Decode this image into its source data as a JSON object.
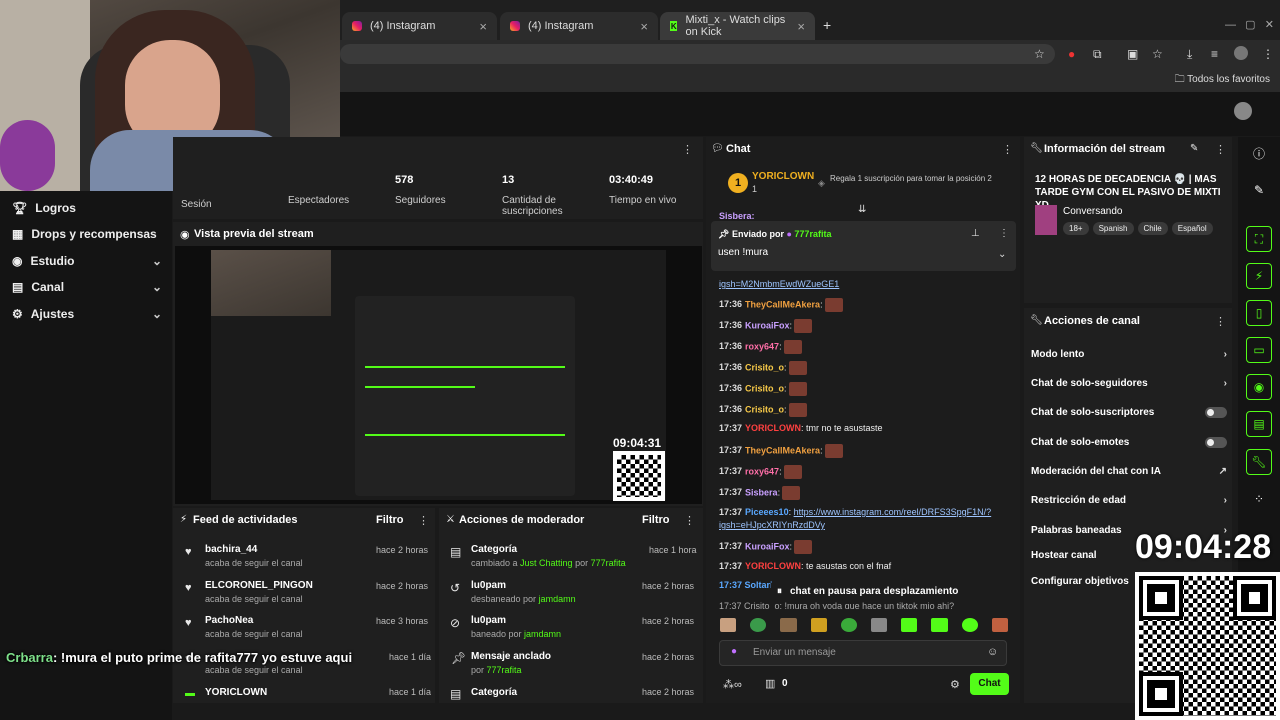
{
  "browser": {
    "tabs": [
      {
        "label": "(4) Instagram",
        "icon": "instagram-icon"
      },
      {
        "label": "(4) Instagram",
        "icon": "instagram-icon"
      },
      {
        "label": "Mixti_x - Watch clips on Kick",
        "icon": "kick-icon"
      }
    ],
    "new_tab": "+",
    "favorites": "Todos los favoritos"
  },
  "nav": {
    "items": [
      {
        "label": "Logros",
        "icon": "trophy-icon",
        "chev": ""
      },
      {
        "label": "Drops y recompensas",
        "icon": "gift-icon",
        "chev": ""
      },
      {
        "label": "Estudio",
        "icon": "studio-icon",
        "chev": "⌄"
      },
      {
        "label": "Canal",
        "icon": "channel-icon",
        "chev": "⌄"
      },
      {
        "label": "Ajustes",
        "icon": "gear-icon",
        "chev": "⌄"
      }
    ]
  },
  "stats": {
    "items": [
      {
        "label": "Sesión",
        "value": ""
      },
      {
        "label": "Espectadores",
        "value": ""
      },
      {
        "label": "Seguidores",
        "value": "578"
      },
      {
        "label": "Cantidad de suscripciones",
        "value": "13"
      },
      {
        "label": "Tiempo en vivo",
        "value": "03:40:49"
      }
    ]
  },
  "preview": {
    "title": "Vista previa del stream",
    "clock": "09:04:31"
  },
  "feed": {
    "title": "Feed de actividades",
    "filter": "Filtro",
    "items": [
      {
        "name": "bachira_44",
        "sub": "acaba de seguir el canal",
        "time": "hace 2 horas"
      },
      {
        "name": "ELCORONEL_PINGON",
        "sub": "acaba de seguir el canal",
        "time": "hace 2 horas"
      },
      {
        "name": "PachoNea",
        "sub": "acaba de seguir el canal",
        "time": "hace 3 horas"
      },
      {
        "name": "",
        "sub": "acaba de seguir el canal",
        "time": "hace 1 día"
      },
      {
        "name": "YORICLOWN",
        "sub": "",
        "time": "hace 1 día"
      }
    ]
  },
  "mod": {
    "title": "Acciones de moderador",
    "filter": "Filtro",
    "items": [
      {
        "name": "Categoría",
        "sub_pre": "cambiado a ",
        "sub_hl": "Just Chatting",
        "sub_mid": " por ",
        "sub_user": "777rafita",
        "time": "hace 1 hora"
      },
      {
        "name": "lu0pam",
        "sub_pre": "desbaneado por ",
        "sub_hl": "",
        "sub_mid": "",
        "sub_user": "jamdamn",
        "time": "hace 2 horas"
      },
      {
        "name": "lu0pam",
        "sub_pre": "baneado por ",
        "sub_hl": "",
        "sub_mid": "",
        "sub_user": "jamdamn",
        "time": "hace 2 horas"
      },
      {
        "name": "Mensaje anclado",
        "sub_pre": "por ",
        "sub_hl": "",
        "sub_mid": "",
        "sub_user": "777rafita",
        "time": "hace 2 horas"
      },
      {
        "name": "Categoría",
        "sub_pre": "",
        "sub_hl": "",
        "sub_mid": "",
        "sub_user": "",
        "time": "hace 2 horas"
      }
    ]
  },
  "overlay_chat": {
    "user": "Crbarra",
    "text": ": !mura el puto prime de rafita777 yo estuve aqui"
  },
  "chat": {
    "title": "Chat",
    "top_gifter": {
      "rank": "1",
      "name": "YORICLOWN",
      "count": "1",
      "text": "Regala 1 suscripción para tomar la posición 2"
    },
    "pinned": {
      "label": "Enviado por",
      "user": "777rafita",
      "text": "usen !mura"
    },
    "partial_top": "Sisbera:",
    "partial_link": "igsh=M2NmbmEwdWZueGE1",
    "messages": [
      {
        "t": "17:36",
        "u": "TheyCallMeAkera",
        "c": "#f0a040",
        "text": ":"
      },
      {
        "t": "17:36",
        "u": "KuroaiFox",
        "c": "#c9a0ff",
        "text": ":"
      },
      {
        "t": "17:36",
        "u": "roxy647",
        "c": "#ff6fa8",
        "text": ":"
      },
      {
        "t": "17:36",
        "u": "Crisito_o",
        "c": "#f7c948",
        "text": ":"
      },
      {
        "t": "17:36",
        "u": "Crisito_o",
        "c": "#f7c948",
        "text": ":"
      },
      {
        "t": "17:36",
        "u": "Crisito_o",
        "c": "#f7c948",
        "text": ":"
      },
      {
        "t": "17:37",
        "u": "YORICLOWN",
        "c": "#ff4040",
        "text": ": tmr no te asustaste"
      },
      {
        "t": "17:37",
        "u": "TheyCallMeAkera",
        "c": "#f0a040",
        "text": ":"
      },
      {
        "t": "17:37",
        "u": "roxy647",
        "c": "#ff6fa8",
        "text": ":"
      },
      {
        "t": "17:37",
        "u": "Sisbera",
        "c": "#c9a0ff",
        "text": ":"
      }
    ],
    "link_msg": {
      "t": "17:37",
      "u": "Piceees10",
      "link": "https://www.instagram.com/reel/DRFS3SpgF1N/?igsh=eHJpcXRIYnRzdDVy"
    },
    "msg_after": [
      {
        "t": "17:37",
        "u": "KuroaiFox",
        "c": "#c9a0ff",
        "text": ":"
      },
      {
        "t": "17:37",
        "u": "YORICLOWN",
        "c": "#ff4040",
        "text": ": te asustas con el fnaf"
      }
    ],
    "partial_bottom": "17:37 Soltario",
    "paused": "chat en pausa para desplazamiento",
    "partial_last": "17:37  Crisito_o: !mura oh yoda que hace un tiktok mio ahi?",
    "input_placeholder": "Enviar un mensaje",
    "counter": "0",
    "send": "Chat"
  },
  "stream_info": {
    "title": "Información del stream",
    "stream_title": "12 HORAS DE DECADENCIA 💀 | MAS TARDE GYM CON EL PASIVO DE MIXTI XD",
    "category": "Conversando",
    "tags": [
      "18+",
      "Spanish",
      "Chile",
      "Español"
    ]
  },
  "channel_actions": {
    "title": "Acciones de canal",
    "items": [
      {
        "label": "Modo lento",
        "ctrl": "chevron"
      },
      {
        "label": "Chat de solo-seguidores",
        "ctrl": "chevron"
      },
      {
        "label": "Chat de solo-suscriptores",
        "ctrl": "toggle"
      },
      {
        "label": "Chat de solo-emotes",
        "ctrl": "toggle"
      },
      {
        "label": "Moderación del chat con IA",
        "ctrl": "external"
      },
      {
        "label": "Restricción de edad",
        "ctrl": "chevron"
      },
      {
        "label": "Palabras baneadas",
        "ctrl": "chevron"
      },
      {
        "label": "Hostear canal",
        "ctrl": ""
      },
      {
        "label": "Configurar objetivos",
        "ctrl": ""
      }
    ]
  },
  "overlay_clock": "09:04:28",
  "colors": {
    "accent": "#53fc18",
    "bg": "#141414",
    "panel": "#1f1f1f"
  }
}
